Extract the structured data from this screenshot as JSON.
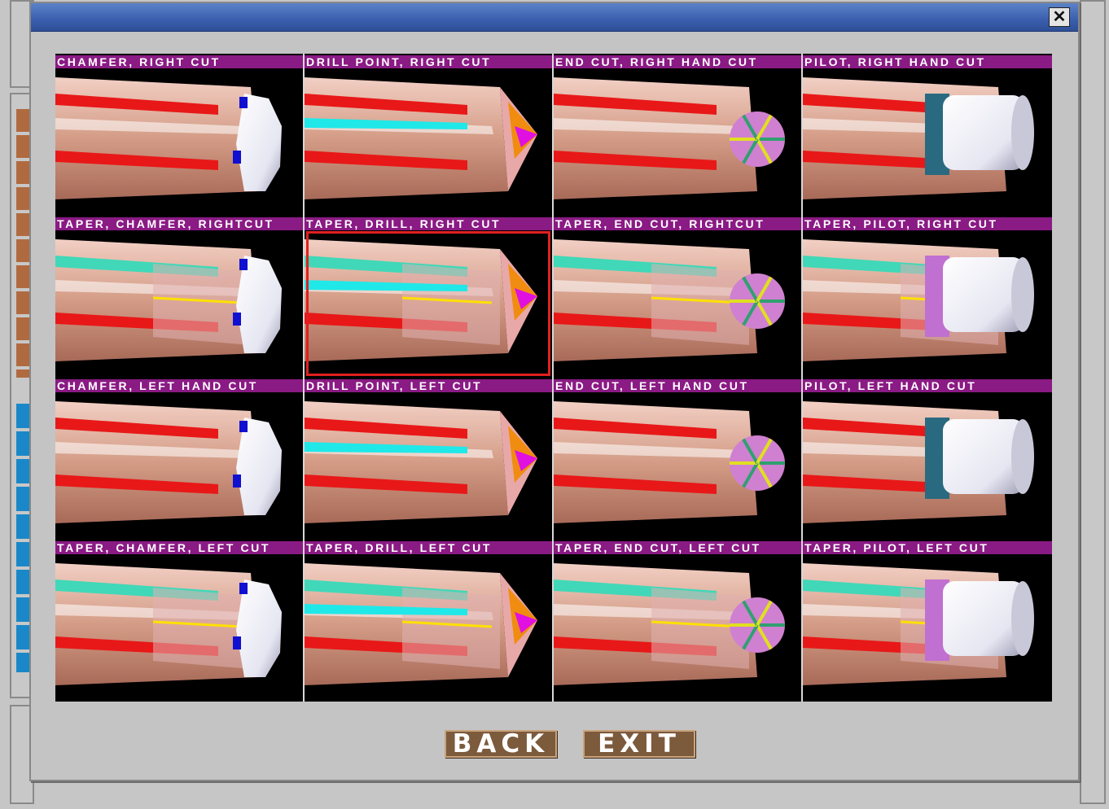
{
  "dialog": {
    "close_symbol": "✕"
  },
  "cells": [
    {
      "label": "CHAMFER,  RIGHT  CUT",
      "variant": "chamfer",
      "taper": false
    },
    {
      "label": "DRILL  POINT,  RIGHT  CUT",
      "variant": "drill",
      "taper": false
    },
    {
      "label": "END  CUT, RIGHT  HAND  CUT",
      "variant": "endcut",
      "taper": false
    },
    {
      "label": "PILOT, RIGHT  HAND  CUT",
      "variant": "pilot",
      "taper": false
    },
    {
      "label": "TAPER, CHAMFER, RIGHTCUT",
      "variant": "chamfer",
      "taper": true
    },
    {
      "label": "TAPER, DRILL, RIGHT  CUT",
      "variant": "drill",
      "taper": true,
      "selected": true
    },
    {
      "label": "TAPER, END  CUT, RIGHTCUT",
      "variant": "endcut",
      "taper": true
    },
    {
      "label": "TAPER, PILOT,  RIGHT  CUT",
      "variant": "pilot",
      "taper": true
    },
    {
      "label": "CHAMFER,  LEFT  HAND  CUT",
      "variant": "chamfer",
      "taper": false
    },
    {
      "label": "DRILL  POINT, LEFT  CUT",
      "variant": "drill",
      "taper": false
    },
    {
      "label": "END  CUT,  LEFT  HAND  CUT",
      "variant": "endcut",
      "taper": false
    },
    {
      "label": "PILOT,  LEFT  HAND  CUT",
      "variant": "pilot",
      "taper": false
    },
    {
      "label": "TAPER, CHAMFER, LEFT  CUT",
      "variant": "chamfer",
      "taper": true
    },
    {
      "label": "TAPER, DRILL, LEFT  CUT",
      "variant": "drill",
      "taper": true
    },
    {
      "label": "TAPER, END  CUT, LEFT  CUT",
      "variant": "endcut",
      "taper": true
    },
    {
      "label": "TAPER, PILOT, LEFT  CUT",
      "variant": "pilot",
      "taper": true
    }
  ],
  "buttons": {
    "back": "BACK",
    "exit": "EXIT"
  },
  "colors": {
    "label_bg": "#8a1a84",
    "selected_border": "#e02020",
    "button_bg": "#7c5a3c"
  }
}
